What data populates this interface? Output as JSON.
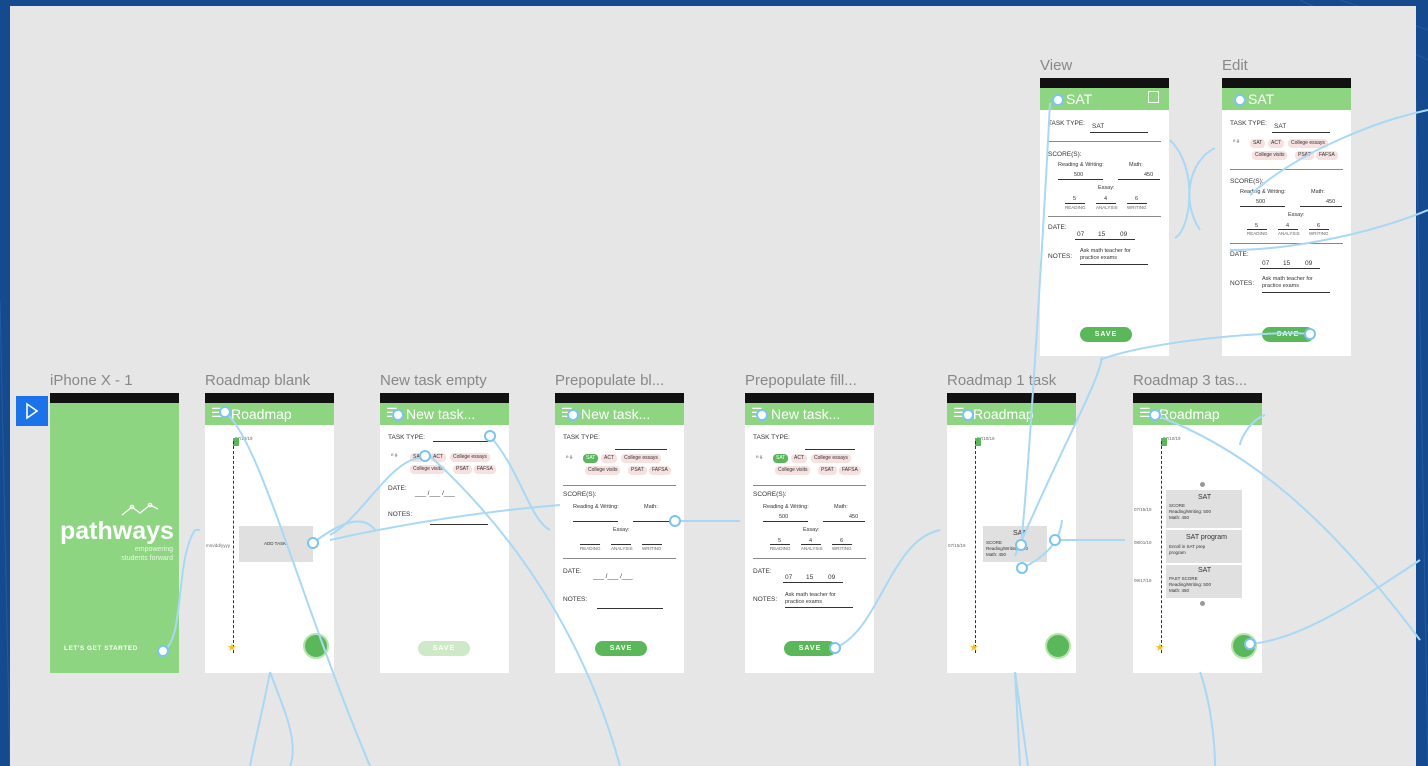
{
  "boards": {
    "iphone": "iPhone X - 1",
    "roadmap_blank": "Roadmap blank",
    "new_task_empty": "New task empty",
    "prepop_blank": "Prepopulate bl...",
    "prepop_filled": "Prepopulate fill...",
    "roadmap_1": "Roadmap 1 task",
    "roadmap_3": "Roadmap 3 tas...",
    "view": "View",
    "edit": "Edit"
  },
  "splash": {
    "logo": "pathways",
    "tagline1": "empowering",
    "tagline2": "students forward",
    "cta": "LET'S GET STARTED"
  },
  "headers": {
    "roadmap": "Roadmap",
    "new_task": "New task...",
    "sat": "SAT"
  },
  "form": {
    "task_type": "TASK TYPE:",
    "eg": "e.g.",
    "chips": [
      "SAT",
      "ACT",
      "College essays",
      "College visits",
      "PSAT",
      "FAFSA"
    ],
    "date": "DATE:",
    "notes": "NOTES:",
    "scores": "SCORE(S):",
    "rw": "Reading & Writing:",
    "math": "Math:",
    "essay": "Essay:",
    "reading": "READING",
    "analysis": "ANALYSIS",
    "writing": "WRITING",
    "save": "SAVE",
    "rw_val": "500",
    "math_val": "450",
    "essay_vals": [
      "5",
      "4",
      "6"
    ],
    "date_vals": [
      "07",
      "15",
      "09"
    ],
    "notes_val1": "Ask math teacher for",
    "notes_val2": "practice exams",
    "sat_val": "SAT",
    "date_blank": "___ /___ /___"
  },
  "roadmap": {
    "start_date": "07/10/19",
    "blank_date": "mm/dd/yyyy",
    "add_task": "ADD TASK",
    "task_date": "07/15/19",
    "task_title": "SAT",
    "task_score": "SCORE",
    "task_rw": "Reading/Writing: 500",
    "task_math": "Math: 450",
    "cards": [
      {
        "date": "07/15/19",
        "title": "SAT",
        "l1": "SCORE",
        "l2": "Reading/Writing: 500",
        "l3": "Math: 450"
      },
      {
        "date": "08/01/19",
        "title": "SAT program",
        "l1": "Enroll in SAT prep",
        "l2": "program",
        "l3": ""
      },
      {
        "date": "09/17/19",
        "title": "SAT",
        "l1": "PAST SCORE",
        "l2": "Reading/Writing: 500",
        "l3": "Math: 450"
      }
    ]
  },
  "colors": {
    "accent": "#8dd580",
    "primary": "#5bb85a",
    "canvas": "#e6e6e6",
    "wire": "#a9d8f5"
  }
}
